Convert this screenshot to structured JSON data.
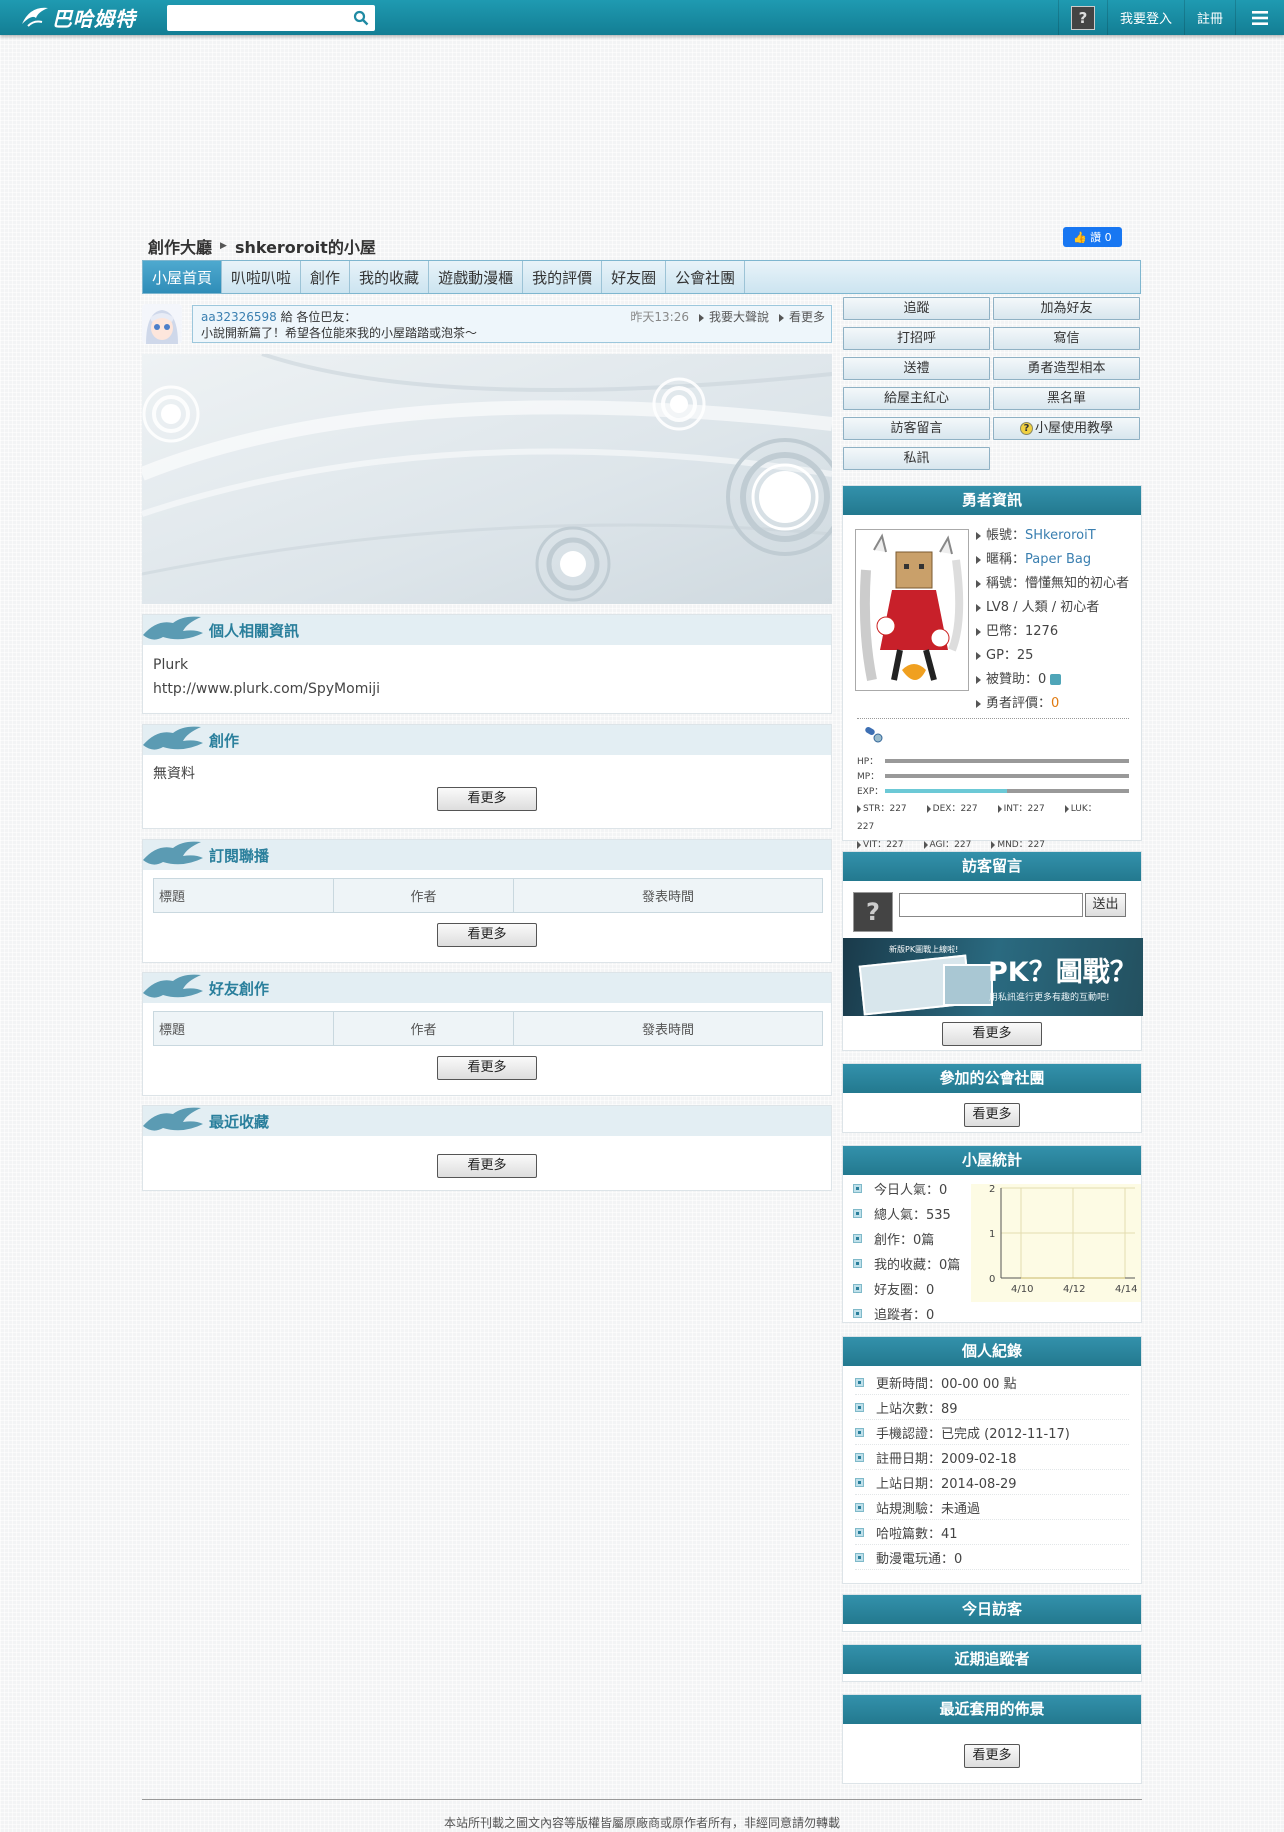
{
  "topbar": {
    "logo": "巴哈姆特",
    "search_placeholder": "",
    "login": "我要登入",
    "register": "註冊",
    "avatar_glyph": "?"
  },
  "breadcrumb": {
    "root": "創作大廳",
    "current": "shkeroroit的小屋"
  },
  "fb_like": {
    "label": "讚 0"
  },
  "tabs": [
    "小屋首頁",
    "叭啦叭啦",
    "創作",
    "我的收藏",
    "遊戲動漫櫃",
    "我的評價",
    "好友圈",
    "公會社團"
  ],
  "notice": {
    "user": "aa32326598",
    "to": " 給 各位巴友：",
    "text": "小說開新篇了！希望各位能來我的小屋踏踏或泡茶～",
    "time": "昨天13:26",
    "shout": "我要大聲說",
    "more": "看更多"
  },
  "sections": {
    "personal": {
      "title": "個人相關資訊",
      "lines": [
        "Plurk",
        "http://www.plurk.com/SpyMomiji"
      ]
    },
    "creation": {
      "title": "創作",
      "empty": "無資料",
      "more": "看更多"
    },
    "subscribe": {
      "title": "訂閱聯播",
      "cols": [
        "標題",
        "作者",
        "發表時間"
      ],
      "more": "看更多"
    },
    "friend": {
      "title": "好友創作",
      "cols": [
        "標題",
        "作者",
        "發表時間"
      ],
      "more": "看更多"
    },
    "recent": {
      "title": "最近收藏",
      "more": "看更多"
    }
  },
  "actions": [
    "追蹤",
    "加為好友",
    "打招呼",
    "寫信",
    "送禮",
    "勇者造型相本",
    "給屋主紅心",
    "黑名單",
    "訪客留言",
    "小屋使用教學",
    "私訊"
  ],
  "hero": {
    "title": "勇者資訊",
    "account_label": "帳號：",
    "account": "SHkeroroiT",
    "nick_label": "暱稱：",
    "nick": "Paper Bag",
    "rank": "稱號：懵懂無知的初心者",
    "level": "LV8 / 人類 / 初心者",
    "coin": "巴幣：1276",
    "gp": "GP：25",
    "sponsor": "被贊助：0",
    "rating_label": "勇者評價：",
    "rating": "0",
    "bars": [
      {
        "label": "HP：",
        "value": 1.0
      },
      {
        "label": "MP：",
        "value": 1.0
      },
      {
        "label": "EXP：",
        "value": 0.5
      }
    ],
    "stats1": [
      "STR：227",
      "DEX：227",
      "INT：227",
      "LUK：227"
    ],
    "stats2": [
      "VIT：227",
      "AGI：227",
      "MND：227"
    ]
  },
  "guestbook": {
    "title": "訪客留言",
    "send": "送出",
    "more": "看更多",
    "ad_title": "PK？圖戰？",
    "ad_sub": "用私訊進行更多有趣的互動吧!",
    "ad_tag": "新版PK圖戰上線啦!"
  },
  "guild": {
    "title": "參加的公會社團",
    "more": "看更多"
  },
  "stats": {
    "title": "小屋統計",
    "items": [
      "今日人氣：0",
      "總人氣：535",
      "創作：0篇",
      "我的收藏：0篇",
      "好友圈：0",
      "追蹤者：0"
    ]
  },
  "chart_data": {
    "type": "line",
    "x": [
      "4/10",
      "4/12",
      "4/14"
    ],
    "yticks": [
      "0",
      "1",
      "2"
    ],
    "ylim": [
      0,
      2
    ],
    "series": [
      {
        "values": [
          0,
          0,
          0
        ]
      }
    ]
  },
  "records": {
    "title": "個人紀錄",
    "items": [
      "更新時間：00-00 00 點",
      "上站次數：89",
      "手機認證：已完成 (2012-11-17)",
      "註冊日期：2009-02-18",
      "上站日期：2014-08-29",
      "站規測驗：未通過",
      "哈啦篇數：41",
      "動漫電玩通：0"
    ]
  },
  "today_visitors": {
    "title": "今日訪客"
  },
  "recent_followers": {
    "title": "近期追蹤者"
  },
  "recent_theme": {
    "title": "最近套用的佈景",
    "more": "看更多"
  },
  "footer": "本站所刊載之圖文內容等版權皆屬原廠商或原作者所有，非經同意請勿轉載"
}
